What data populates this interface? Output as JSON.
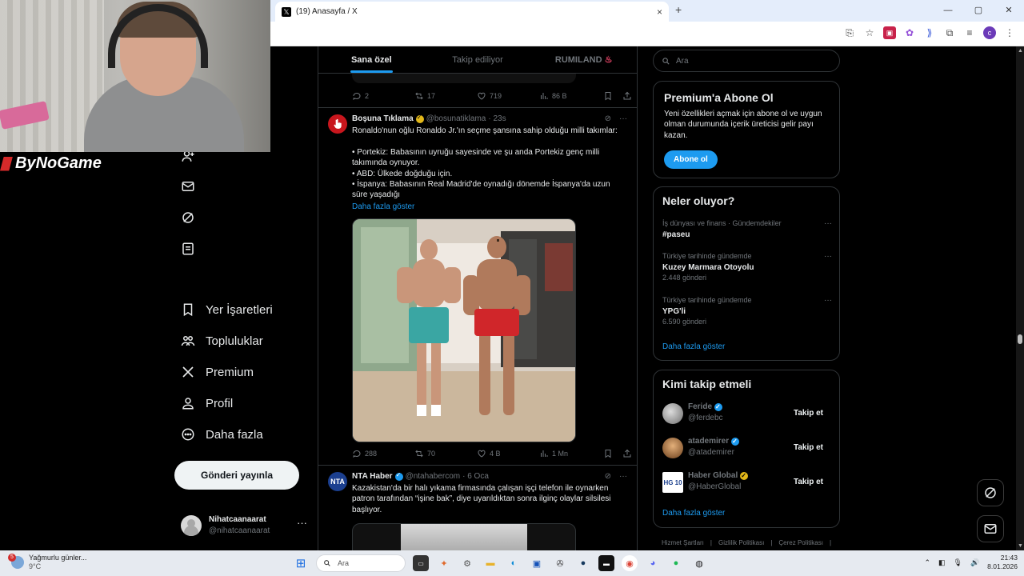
{
  "overlay": {
    "channel_logo": "ByNoGame"
  },
  "browser": {
    "tab_title": "(19) Anasayfa / X",
    "new_tab": "+",
    "window_controls": [
      "—",
      "▢",
      "✕"
    ]
  },
  "nav": {
    "items": [
      {
        "label": "Yer İşaretleri",
        "icon": "bookmark-icon"
      },
      {
        "label": "Topluluklar",
        "icon": "communities-icon"
      },
      {
        "label": "Premium",
        "icon": "x-logo-icon"
      },
      {
        "label": "Profil",
        "icon": "profile-icon"
      },
      {
        "label": "Daha fazla",
        "icon": "more-circle-icon"
      }
    ],
    "post_button": "Gönderi yayınla",
    "account": {
      "name": "Nihatcaanaarat",
      "handle": "@nihatcaanaarat",
      "more": "···"
    }
  },
  "timeline": {
    "tabs": [
      "Sana özel",
      "Takip ediliyor",
      "RUMILAND"
    ],
    "rumiland_emoji": "♨",
    "prev_tweet_stats": {
      "replies": "2",
      "reposts": "17",
      "likes": "719",
      "views": "86 B"
    },
    "tweet1": {
      "name": "Boşuna Tıklama",
      "handle": "@bosunatiklama",
      "time": "· 23s",
      "text": "Ronaldo'nun oğlu Ronaldo Jr.'ın seçme şansına sahip olduğu milli takımlar:\n\n• Portekiz: Babasının uyruğu sayesinde ve şu anda Portekiz genç milli takımında oynuyor.\n• ABD: Ülkede doğduğu için.\n• İspanya: Babasının Real Madrid'de oynadığı dönemde İspanya'da uzun süre yaşadığı",
      "show_more": "Daha fazla göster",
      "stats": {
        "replies": "288",
        "reposts": "70",
        "likes": "4 B",
        "views": "1 Mn"
      }
    },
    "tweet2": {
      "avatar_text": "NTA",
      "name": "NTA Haber",
      "handle": "@ntahabercom",
      "time": "· 6 Oca",
      "text": "Kazakistan'da bir halı yıkama firmasında çalışan işçi telefon ile oynarken patron tarafından “işine bak”, diye uyarıldıktan sonra ilginç olaylar silsilesi başlıyor."
    }
  },
  "sidebar": {
    "search_placeholder": "Ara",
    "premium": {
      "title": "Premium'a Abone Ol",
      "text": "Yeni özellikleri açmak için abone ol ve uygun olman durumunda içerik üreticisi gelir payı kazan.",
      "button": "Abone ol"
    },
    "trends": {
      "title": "Neler oluyor?",
      "items": [
        {
          "context": "İş dünyası ve finans · Gündemdekiler",
          "name": "#paseu",
          "count": ""
        },
        {
          "context": "Türkiye tarihinde gündemde",
          "name": "Kuzey Marmara Otoyolu",
          "count": "2.448 gönderi"
        },
        {
          "context": "Türkiye tarihinde gündemde",
          "name": "YPG'li",
          "count": "6.590 gönderi"
        }
      ],
      "show_more": "Daha fazla göster"
    },
    "who_to_follow": {
      "title": "Kimi takip etmeli",
      "items": [
        {
          "name": "Feride",
          "handle": "@ferdebc",
          "badge": "blue"
        },
        {
          "name": "atademirer",
          "handle": "@atademirer",
          "badge": "blue"
        },
        {
          "name": "Haber Global",
          "handle": "@HaberGlobal",
          "badge": "gold",
          "avatar_text": "HG 10"
        }
      ],
      "follow_label": "Takip et",
      "show_more": "Daha fazla göster"
    },
    "footer": [
      "Hizmet Şartları",
      "|",
      "Gizlilik Politikası",
      "|",
      "Çerez Politikası",
      "|"
    ]
  },
  "taskbar": {
    "weather_badge": "5",
    "weather_text": "Yağmurlu günler...",
    "temperature": "9°C",
    "search_placeholder": "Ara",
    "time": "21:43",
    "date": "8.01.2026"
  }
}
